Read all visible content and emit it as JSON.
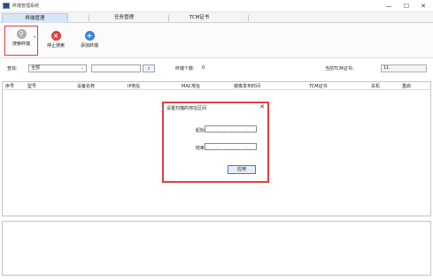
{
  "window": {
    "title": "终端管理系统",
    "minimize": "—",
    "maximize": "☐",
    "close": "✕"
  },
  "tabs": [
    {
      "label": "终端管理",
      "active": true
    },
    {
      "label": "任务管理",
      "active": false
    },
    {
      "label": "TCM证书",
      "active": false
    }
  ],
  "toolbar": {
    "search_terminal": "搜索终端",
    "stop_search": "停止搜索",
    "add_terminal": "添加终端",
    "colors": {
      "search": "#a6acb3",
      "stop": "#e03b3b",
      "add": "#3a86d6"
    }
  },
  "filter": {
    "find_label": "查找:",
    "select_value": "全部",
    "search_value": "",
    "count_label": "终端个数:",
    "count_value": "0",
    "tcm_label": "当前TCM证书:",
    "tcm_value": "11"
  },
  "table": {
    "columns": [
      "序号",
      "型号",
      "设备名称",
      "IP地址",
      "MAC地址",
      "镜像发布时间",
      "TCM证书",
      "关机",
      "重启"
    ],
    "rows": []
  },
  "dialog": {
    "title": "设置扫描的地址区间",
    "start_label": "起始IP地址:",
    "start_value": ". . .",
    "end_label": "结束IP地址:",
    "end_value": ". . .",
    "apply_label": "应用",
    "close_glyph": "✕"
  },
  "highlight_color": "#e04040"
}
